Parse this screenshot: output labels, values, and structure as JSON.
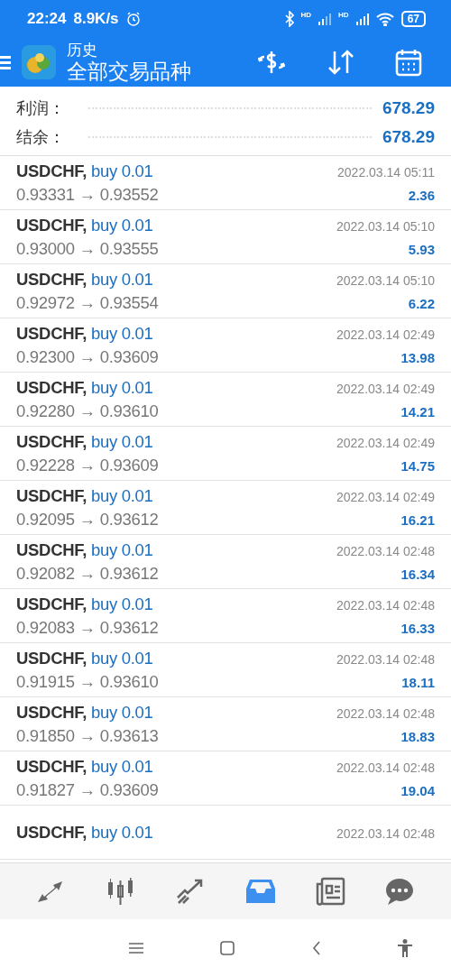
{
  "status_bar": {
    "time": "22:24",
    "speed": "8.9K/s",
    "signal_label_1": "HD",
    "signal_label_2": "HD",
    "battery": "67"
  },
  "header": {
    "title": "历史",
    "subtitle": "全部交易品种"
  },
  "summary": [
    {
      "label": "利润：",
      "value": "678.29"
    },
    {
      "label": "结余：",
      "value": "678.29"
    }
  ],
  "trades": [
    {
      "symbol": "USDCHF,",
      "order": "buy 0.01",
      "prices": "0.93331 → 0.93552",
      "time": "2022.03.14 05:11",
      "profit": "2.36"
    },
    {
      "symbol": "USDCHF,",
      "order": "buy 0.01",
      "prices": "0.93000 → 0.93555",
      "time": "2022.03.14 05:10",
      "profit": "5.93"
    },
    {
      "symbol": "USDCHF,",
      "order": "buy 0.01",
      "prices": "0.92972 → 0.93554",
      "time": "2022.03.14 05:10",
      "profit": "6.22"
    },
    {
      "symbol": "USDCHF,",
      "order": "buy 0.01",
      "prices": "0.92300 → 0.93609",
      "time": "2022.03.14 02:49",
      "profit": "13.98"
    },
    {
      "symbol": "USDCHF,",
      "order": "buy 0.01",
      "prices": "0.92280 → 0.93610",
      "time": "2022.03.14 02:49",
      "profit": "14.21"
    },
    {
      "symbol": "USDCHF,",
      "order": "buy 0.01",
      "prices": "0.92228 → 0.93609",
      "time": "2022.03.14 02:49",
      "profit": "14.75"
    },
    {
      "symbol": "USDCHF,",
      "order": "buy 0.01",
      "prices": "0.92095 → 0.93612",
      "time": "2022.03.14 02:49",
      "profit": "16.21"
    },
    {
      "symbol": "USDCHF,",
      "order": "buy 0.01",
      "prices": "0.92082 → 0.93612",
      "time": "2022.03.14 02:48",
      "profit": "16.34"
    },
    {
      "symbol": "USDCHF,",
      "order": "buy 0.01",
      "prices": "0.92083 → 0.93612",
      "time": "2022.03.14 02:48",
      "profit": "16.33"
    },
    {
      "symbol": "USDCHF,",
      "order": "buy 0.01",
      "prices": "0.91915 → 0.93610",
      "time": "2022.03.14 02:48",
      "profit": "18.11"
    },
    {
      "symbol": "USDCHF,",
      "order": "buy 0.01",
      "prices": "0.91850 → 0.93613",
      "time": "2022.03.14 02:48",
      "profit": "18.83"
    },
    {
      "symbol": "USDCHF,",
      "order": "buy 0.01",
      "prices": "0.91827 → 0.93609",
      "time": "2022.03.14 02:48",
      "profit": "19.04"
    },
    {
      "symbol": "USDCHF,",
      "order": "buy 0.01",
      "time": "2022.03.14 02:48"
    }
  ],
  "bottom_nav": [
    {
      "kind": "quotes",
      "selected": false
    },
    {
      "kind": "chart",
      "selected": false
    },
    {
      "kind": "trade",
      "selected": false
    },
    {
      "kind": "history",
      "selected": true
    },
    {
      "kind": "news",
      "selected": false
    },
    {
      "kind": "chat",
      "selected": false
    }
  ]
}
